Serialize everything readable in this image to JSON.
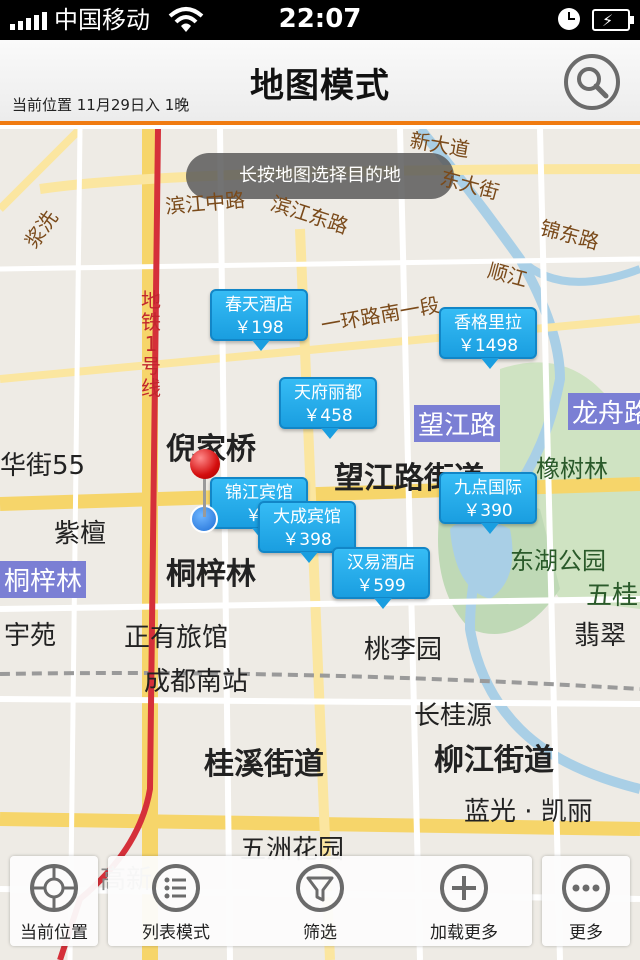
{
  "status_bar": {
    "carrier": "中国移动",
    "time": "22:07"
  },
  "header": {
    "title": "地图模式",
    "subtitle": "当前位置  11月29日入  1晚",
    "search_icon": "search-icon"
  },
  "map": {
    "hint": "长按地图选择目的地",
    "labels": {
      "ni_jia_qiao": "倪家桥",
      "tong_zi_lin": "桐梓林",
      "tong_zi_lin_left": "桐梓林",
      "hua_jie": "华街55",
      "zi_tan": "紫檀",
      "yu_yuan": "宇苑",
      "zheng_you": "正有旅馆",
      "chengdu_nan": "成都南站",
      "gui_xi": "桂溪街道",
      "liu_jiang": "柳江街道",
      "wang_jiang_jd": "望江路街道",
      "wang_jiang_lu": "望江路",
      "long_zhou_lu": "龙舟路",
      "xiang_shu_lin": "橡树林",
      "dong_hu": "东湖公园",
      "wu_gui": "五桂",
      "fei_cui": "翡翠",
      "tao_li_yuan": "桃李园",
      "chang_gui_yuan": "长桂源",
      "lan_guang": "蓝光 · 凯丽",
      "wu_zhou": "五洲花园",
      "gao_xin": "高新",
      "jiang_yu": "桂溪",
      "binjiang_zhong": "滨江中路",
      "binjiang_dong": "滨江东路",
      "huanlu_nan": "一环路南一段",
      "dong_da_jie": "东大街",
      "jin_dong_lu": "锦东路",
      "shun_jiang": "顺江",
      "jiang_xiang": "浆洗",
      "xin_da_jie": "新大道",
      "metro_line": "地铁1号线"
    },
    "hotels": [
      {
        "name": "春天酒店",
        "price": "￥198"
      },
      {
        "name": "香格里拉",
        "price": "￥1498"
      },
      {
        "name": "天府丽都",
        "price": "￥458"
      },
      {
        "name": "锦江宾馆",
        "price": "￥1"
      },
      {
        "name": "大成宾馆",
        "price": "￥398"
      },
      {
        "name": "九点国际",
        "price": "￥390"
      },
      {
        "name": "汉易酒店",
        "price": "￥599"
      }
    ]
  },
  "toolbar": {
    "items": [
      {
        "label": "当前位置",
        "icon": "crosshair-icon"
      },
      {
        "label": "列表模式",
        "icon": "list-icon"
      },
      {
        "label": "筛选",
        "icon": "filter-icon"
      },
      {
        "label": "加载更多",
        "icon": "plus-icon"
      },
      {
        "label": "更多",
        "icon": "more-icon"
      }
    ]
  }
}
